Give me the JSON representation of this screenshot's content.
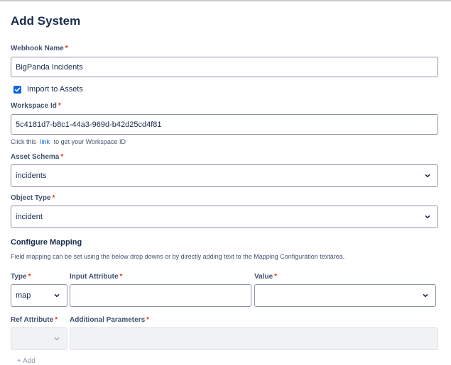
{
  "page": {
    "title": "Add System"
  },
  "webhook": {
    "label": "Webhook Name",
    "required": "*",
    "value": "BigPanda Incidents"
  },
  "import_assets": {
    "label": "Import to Assets",
    "checked": true
  },
  "workspace": {
    "label": "Workspace Id",
    "required": "*",
    "value": "5c4181d7-b8c1-44a3-969d-b42d25cd4f81",
    "help_prefix": "Click this",
    "help_link": "link",
    "help_suffix": "to get your Workspace ID"
  },
  "asset_schema": {
    "label": "Asset Schema",
    "required": "*",
    "value": "incidents"
  },
  "object_type": {
    "label": "Object Type",
    "required": "*",
    "value": "incident"
  },
  "mapping": {
    "title": "Configure Mapping",
    "description": "Field mapping can be set using the below drop downs or by directly adding text to the Mapping Configuration textarea.",
    "type_label": "Type",
    "type_value": "map",
    "input_label": "Input Attribute",
    "input_value": "",
    "value_label": "Value",
    "value_value": "",
    "ref_label": "Ref Attribute",
    "ref_value": "",
    "params_label": "Additional Parameters",
    "params_value": "",
    "required": "*",
    "add_label": "+ Add"
  },
  "colors": {
    "accent": "#0c66e4",
    "required": "#de350b"
  }
}
